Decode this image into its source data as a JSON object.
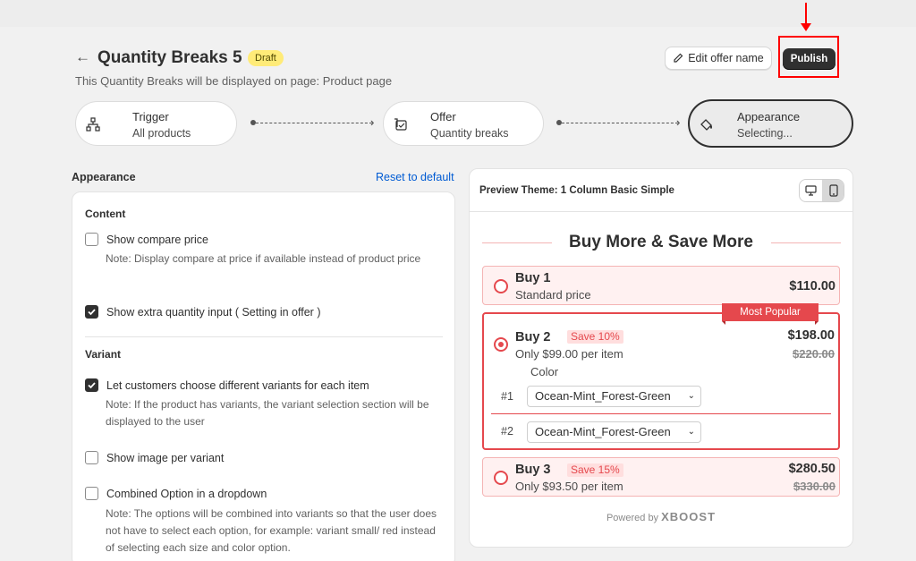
{
  "header": {
    "back_icon": "arrow-left-icon",
    "title": "Quantity Breaks 5",
    "badge": "Draft",
    "subtitle": "This Quantity Breaks will be displayed on page: Product page",
    "edit_label": "Edit offer name",
    "publish_label": "Publish"
  },
  "steps": [
    {
      "title": "Trigger",
      "subtitle": "All products",
      "icon": "sitemap-icon"
    },
    {
      "title": "Offer",
      "subtitle": "Quantity breaks",
      "icon": "offer-icon"
    },
    {
      "title": "Appearance",
      "subtitle": "Selecting...",
      "icon": "paint-bucket-icon"
    }
  ],
  "appearance": {
    "section_title": "Appearance",
    "reset_label": "Reset to default",
    "content": {
      "title": "Content",
      "compare_label": "Show compare price",
      "compare_checked": false,
      "compare_note": "Note: Display compare at price if available instead of product price",
      "extra_label": "Show extra quantity input ( Setting in offer )",
      "extra_checked": true
    },
    "variant": {
      "title": "Variant",
      "choose_label": "Let customers choose different variants for each item",
      "choose_checked": true,
      "choose_note": "Note: If the product has variants, the variant selection section will be displayed to the user",
      "image_label": "Show image per variant",
      "image_checked": false,
      "combined_label": "Combined Option in a dropdown",
      "combined_checked": false,
      "combined_note": "Note: The options will be combined into variants so that the user does not have to select each option, for example: variant small/ red instead of selecting each size and color option."
    }
  },
  "preview": {
    "title": "Preview Theme: 1 Column Basic Simple",
    "heading": "Buy More & Save More",
    "tiers": [
      {
        "name": "Buy 1",
        "sub": "Standard price",
        "price": "$110.00"
      },
      {
        "name": "Buy 2",
        "save": "Save 10%",
        "sub": "Only $99.00 per item",
        "price": "$198.00",
        "compare": "$220.00",
        "badge": "Most Popular",
        "option_label": "Color",
        "variants": [
          {
            "num": "#1",
            "value": "Ocean-Mint_Forest-Green"
          },
          {
            "num": "#2",
            "value": "Ocean-Mint_Forest-Green"
          }
        ]
      },
      {
        "name": "Buy 3",
        "save": "Save 15%",
        "sub": "Only $93.50 per item",
        "price": "$280.50",
        "compare": "$330.00"
      }
    ],
    "powered_by": "Powered by",
    "brand": "XBOOST"
  },
  "colors": {
    "accent": "#e5484d",
    "primary": "#303030",
    "link": "#005bd3",
    "annotation": "#ff0000"
  }
}
